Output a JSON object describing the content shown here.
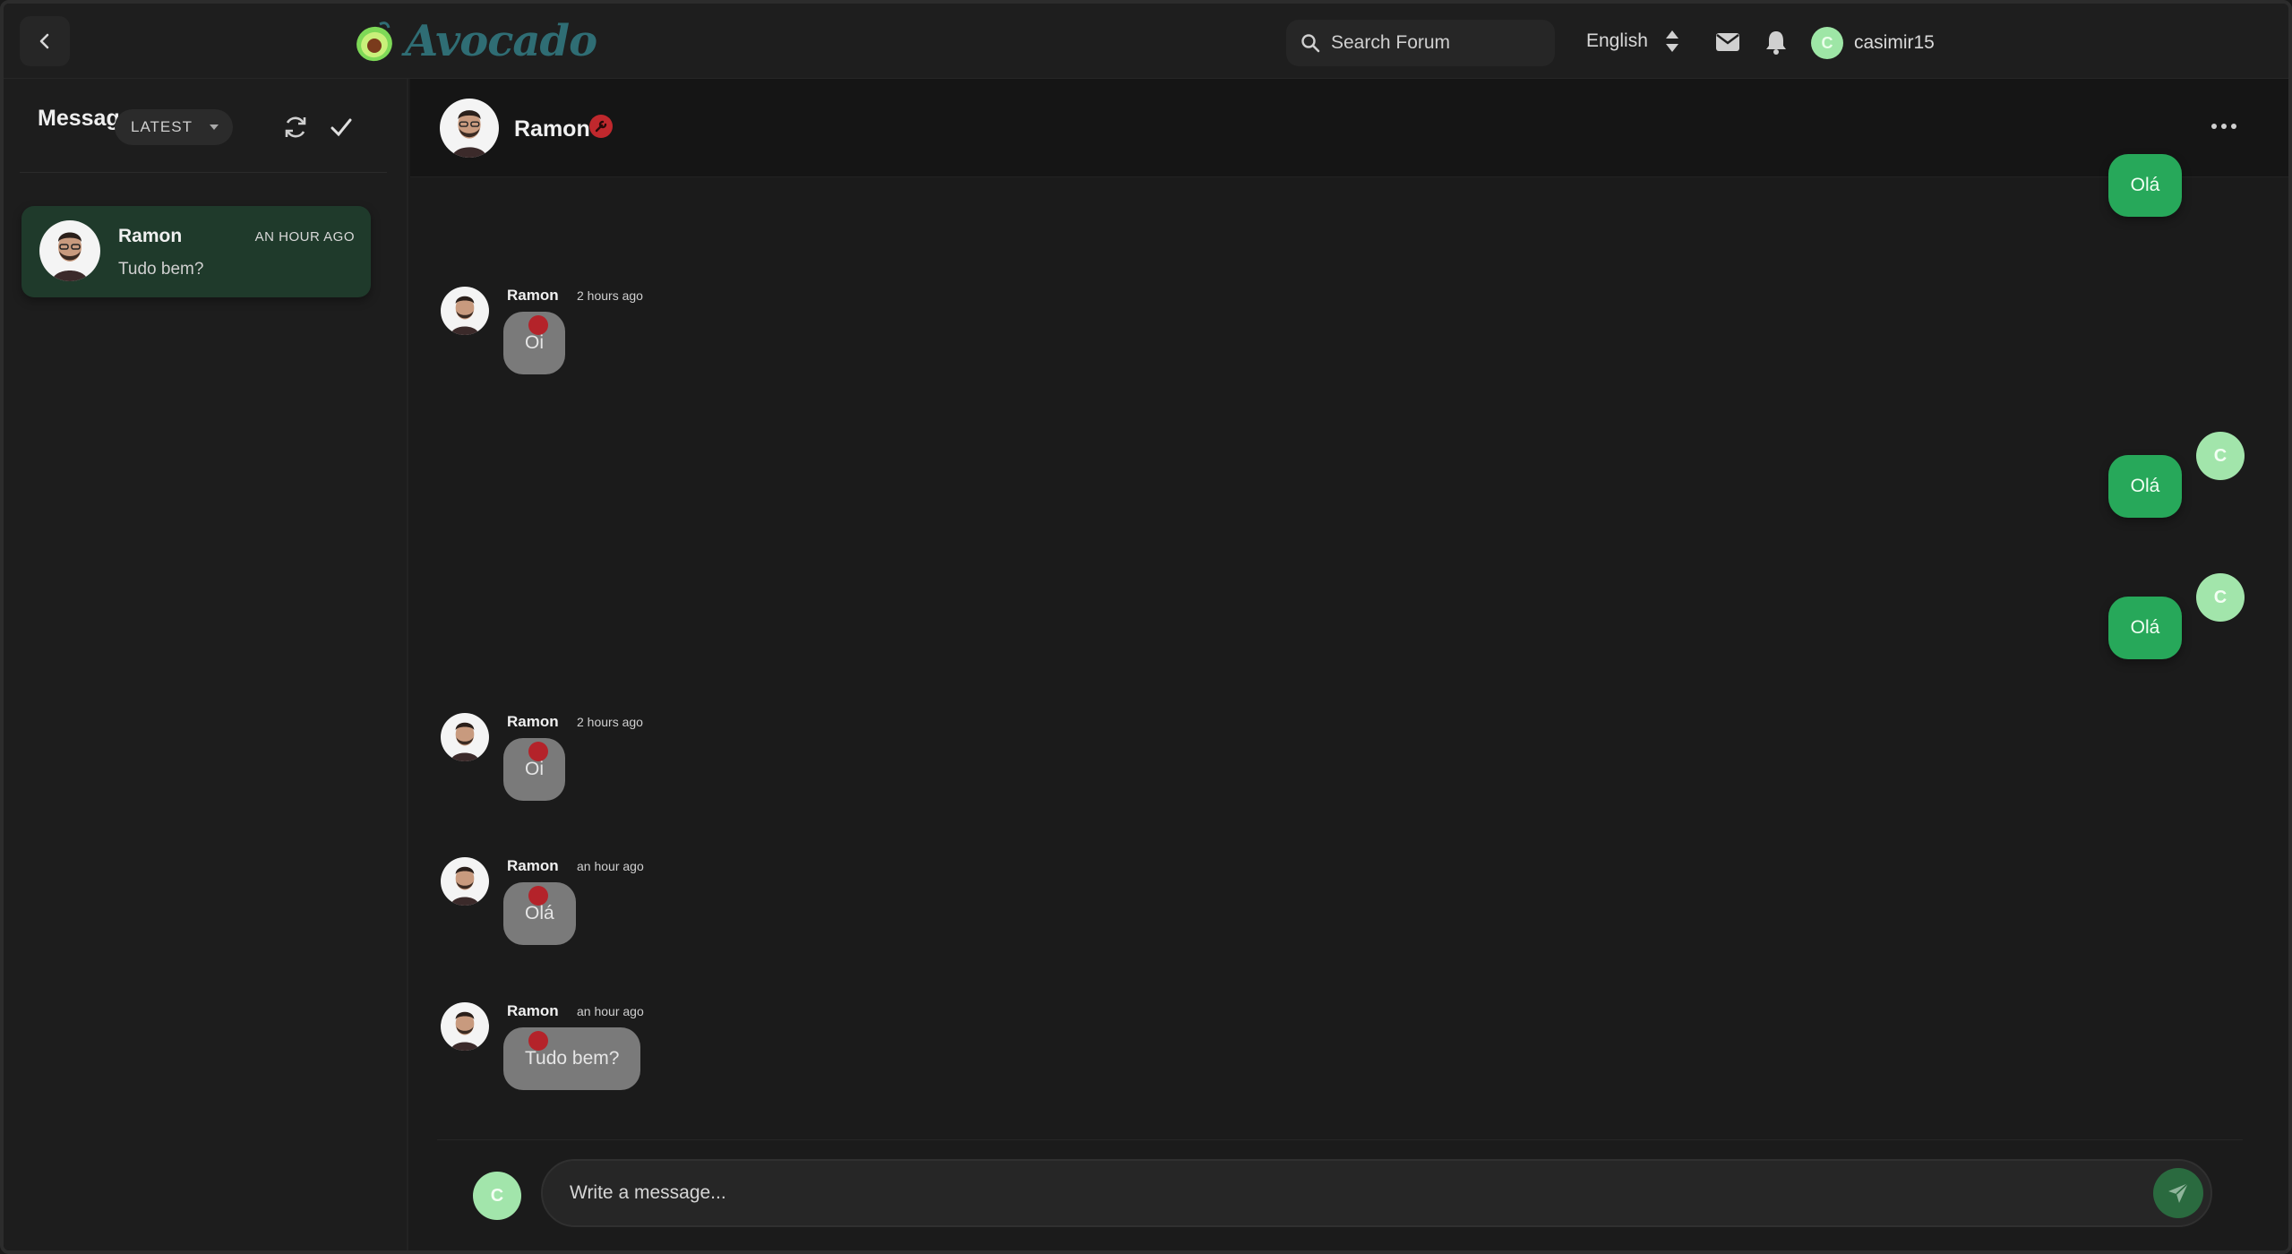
{
  "topbar": {
    "logo_text": "Avocado",
    "search_placeholder": "Search Forum",
    "language": "English",
    "username": "casimir15",
    "user_initial": "C"
  },
  "sidebar": {
    "title": "Messages",
    "sort_label": "LATEST",
    "conversations": [
      {
        "name": "Ramon",
        "time": "AN HOUR AGO",
        "preview": "Tudo bem?"
      }
    ]
  },
  "chat": {
    "header_name": "Ramon",
    "messages": [
      {
        "side": "out",
        "text": "Olá",
        "initial": ""
      },
      {
        "side": "in",
        "author": "Ramon",
        "time": "2 hours ago",
        "text": "Oi"
      },
      {
        "side": "out",
        "text": "Olá",
        "initial": "C"
      },
      {
        "side": "out",
        "text": "Olá",
        "initial": "C"
      },
      {
        "side": "in",
        "author": "Ramon",
        "time": "2 hours ago",
        "text": "Oi"
      },
      {
        "side": "in",
        "author": "Ramon",
        "time": "an hour ago",
        "text": "Olá"
      },
      {
        "side": "in",
        "author": "Ramon",
        "time": "an hour ago",
        "text": "Tudo bem?"
      }
    ],
    "composer_placeholder": "Write a message...",
    "composer_initial": "C"
  },
  "colors": {
    "accent_green": "#27a85a",
    "avatar_green": "#a2e5ab",
    "badge_red": "#c0282d",
    "logo_teal": "#2f6d74"
  },
  "icons": {
    "back": "chevron-left-icon",
    "search": "search-icon",
    "language_toggle": "sort-arrows-icon",
    "mail": "envelope-icon",
    "notifications": "bell-icon",
    "refresh": "refresh-icon",
    "mark_read": "check-icon",
    "more": "more-horizontal-icon",
    "send": "send-icon",
    "badge": "wrench-badge-icon"
  }
}
